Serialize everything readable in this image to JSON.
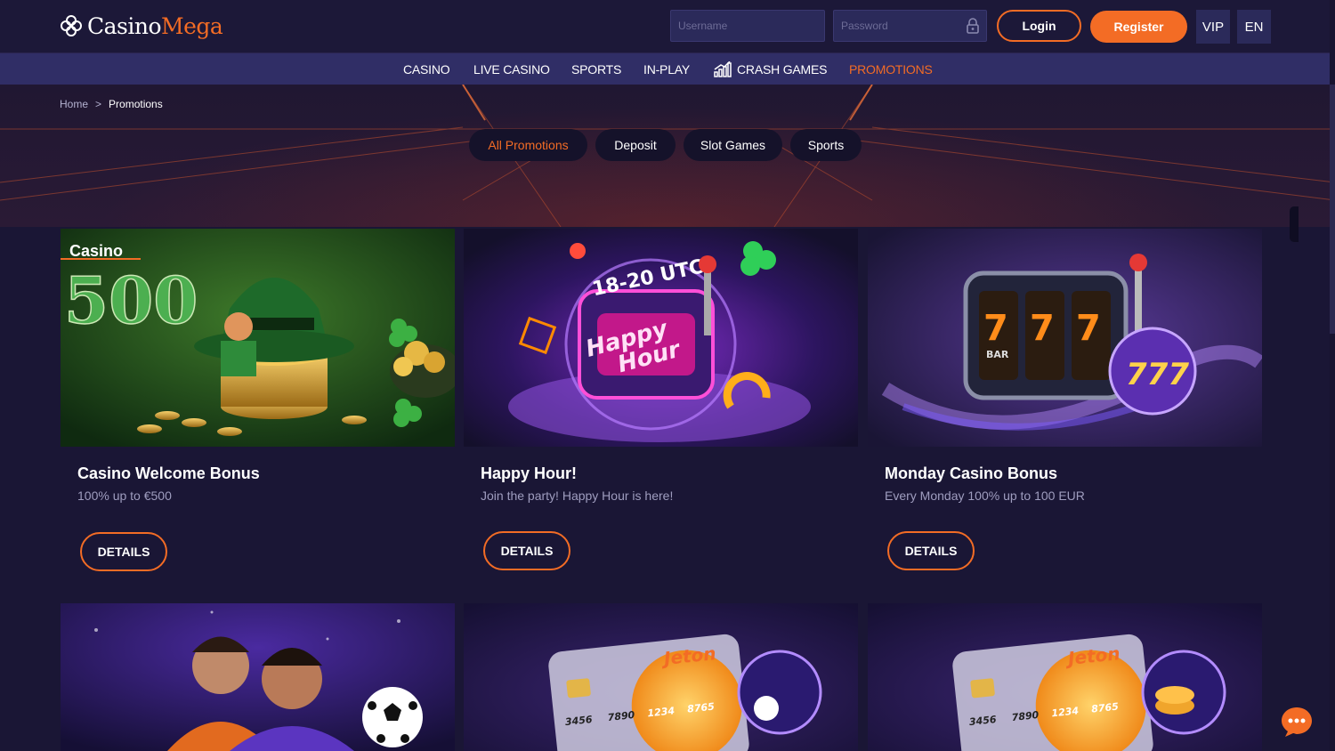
{
  "header": {
    "logo_part1": "Casino",
    "logo_part2": "Mega",
    "username_placeholder": "Username",
    "password_placeholder": "Password",
    "login_label": "Login",
    "register_label": "Register",
    "vip_label": "VIP",
    "lang_label": "EN"
  },
  "nav": {
    "items": [
      {
        "label": "CASINO"
      },
      {
        "label": "LIVE CASINO"
      },
      {
        "label": "SPORTS"
      },
      {
        "label": "IN-PLAY"
      },
      {
        "label": "CRASH GAMES",
        "icon": "bar-chart-icon"
      },
      {
        "label": "PROMOTIONS",
        "active": true
      }
    ]
  },
  "breadcrumb": {
    "home": "Home",
    "separator": ">",
    "current": "Promotions"
  },
  "filters": [
    {
      "label": "All Promotions",
      "active": true
    },
    {
      "label": "Deposit"
    },
    {
      "label": "Slot Games"
    },
    {
      "label": "Sports"
    }
  ],
  "promotions": [
    {
      "title": "Casino Welcome Bonus",
      "subtitle": "100% up to €500",
      "button": "DETAILS",
      "image_text_small": "Casino",
      "image_text_big": "500"
    },
    {
      "title": "Happy Hour!",
      "subtitle": "Join the party! Happy Hour is here!",
      "button": "DETAILS",
      "image_text_time": "18-20 UTC",
      "image_text_line1": "Happy",
      "image_text_line2": "Hour"
    },
    {
      "title": "Monday Casino Bonus",
      "subtitle": "Every Monday 100% up to 100 EUR",
      "button": "DETAILS",
      "image_text_bar": "BAR"
    }
  ],
  "second_row": {
    "card_brand": "Jeton",
    "card_numbers": [
      "3456",
      "7890",
      "1234",
      "8765"
    ]
  },
  "colors": {
    "accent": "#f36c25",
    "background": "#1a1635",
    "nav_bg": "#302e66",
    "input_bg": "#2b2a5a"
  }
}
